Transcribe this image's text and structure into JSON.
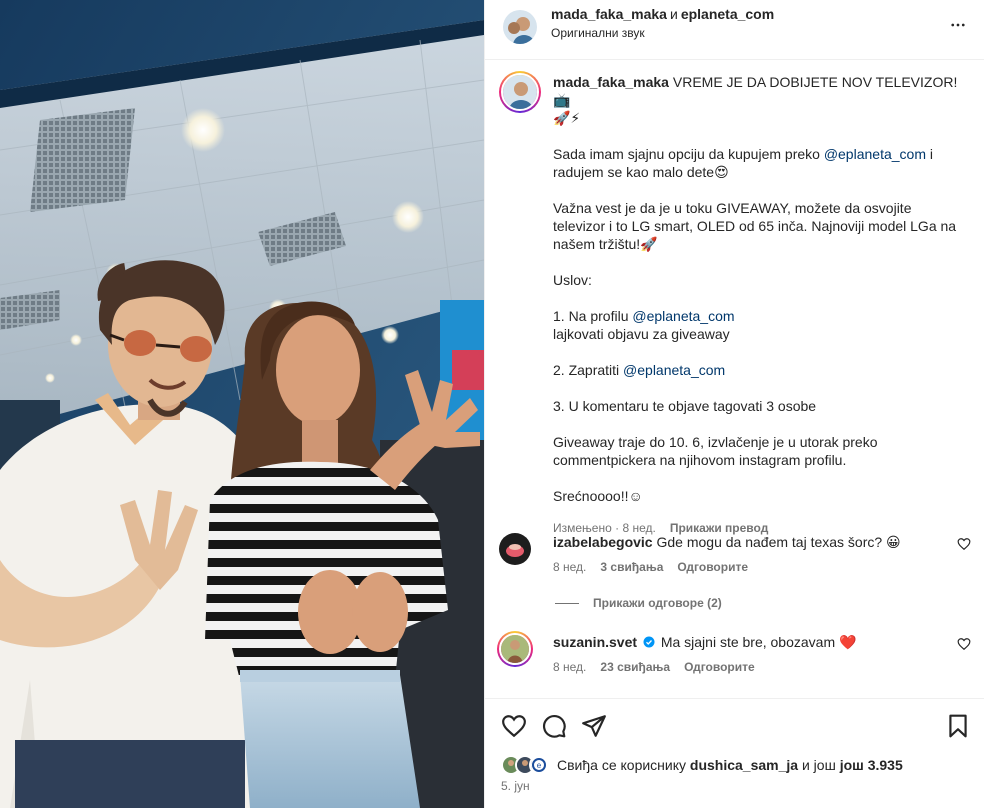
{
  "header": {
    "user1": "mada_faka_maka",
    "conj": "и",
    "user2": "eplaneta_com",
    "audio": "Оригинални звук",
    "more_icon": "more-horizontal-icon"
  },
  "caption": {
    "username": "mada_faka_maka",
    "title": "VREME JE DA DOBIJETE NOV TELEVIZOR!📺",
    "title2": "🚀⚡",
    "p1_a": "Sada imam sjajnu opciju da kupujem preko ",
    "p1_mention": "@eplaneta_com",
    "p1_b": " i radujem se kao malo dete😍",
    "p2": "Važna vest je da je u toku GIVEAWAY, možete da osvojite televizor i to LG smart, OLED od 65 inča. Najnoviji model LGa na našem tržištu!🚀",
    "p3": "Uslov:",
    "p4_a": "1. Na profilu ",
    "p4_mention": "@eplaneta_com",
    "p4_b": "lajkovati objavu za giveaway",
    "p5_a": "2. Zapratiti ",
    "p5_mention": "@eplaneta_com",
    "p6": "3. U komentaru te objave tagovati 3 osobe",
    "p7": "Giveaway traje do 10. 6, izvlačenje je u utorak preko commentpickera na njihovom instagram profilu.",
    "p8": "Srećnoooo!!☺",
    "edited": "Измењено · 8 нед.",
    "translate": "Прикажи превод"
  },
  "comments": [
    {
      "username": "izabelabegovic",
      "text": "Gde mogu da nađem taj texas šorc? 😀",
      "age": "8 нед.",
      "likes": "3 свиђања",
      "reply": "Одговорите",
      "view_replies": "Прикажи одговоре (2)"
    },
    {
      "username": "suzanin.svet",
      "text": "Ma sjajni ste bre, obozavam ❤️",
      "age": "8 нед.",
      "likes": "23 свиђања",
      "reply": "Одговорите"
    }
  ],
  "actions": {
    "icons": [
      "heart-icon",
      "comment-icon",
      "share-icon",
      "bookmark-icon"
    ],
    "likes_prefix": "Свиђа се кориснику ",
    "likes_user": "dushica_sam_ja",
    "likes_mid": " и још ",
    "likes_count": "још 3.935",
    "date": "5. јун"
  },
  "colors": {
    "mention": "#00376b",
    "meta": "#737373",
    "verified": "#0095f6",
    "heart": "#ed4956"
  }
}
